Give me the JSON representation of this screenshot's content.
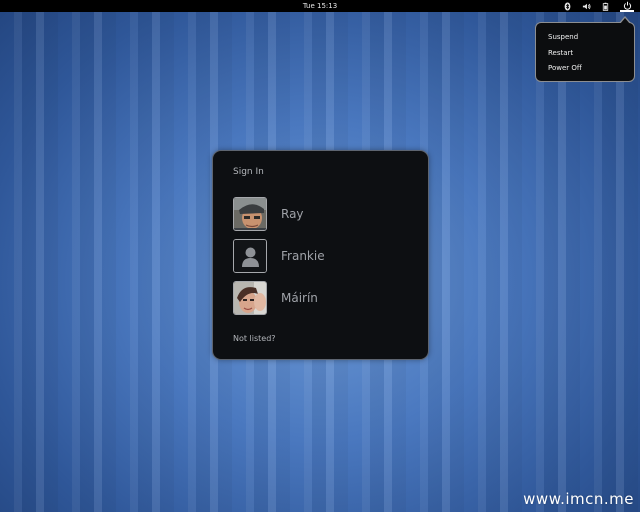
{
  "topbar": {
    "clock": "Tue 15:13",
    "tray_icons": [
      "bluetooth-icon",
      "volume-icon",
      "battery-icon",
      "power-icon"
    ]
  },
  "power_menu": {
    "items": [
      {
        "label": "Suspend"
      },
      {
        "label": "Restart"
      },
      {
        "label": "Power Off"
      }
    ]
  },
  "signin": {
    "title": "Sign In",
    "users": [
      {
        "name": "Ray",
        "avatar": "photo"
      },
      {
        "name": "Frankie",
        "avatar": "default-user-icon"
      },
      {
        "name": "Máirín",
        "avatar": "photo"
      }
    ],
    "not_listed": "Not listed?"
  },
  "watermark": "www.imcn.me",
  "colors": {
    "background": "#3a64a8",
    "panel": "#0d0f12",
    "topbar": "#000000",
    "text_dim": "#9fa2a8"
  }
}
